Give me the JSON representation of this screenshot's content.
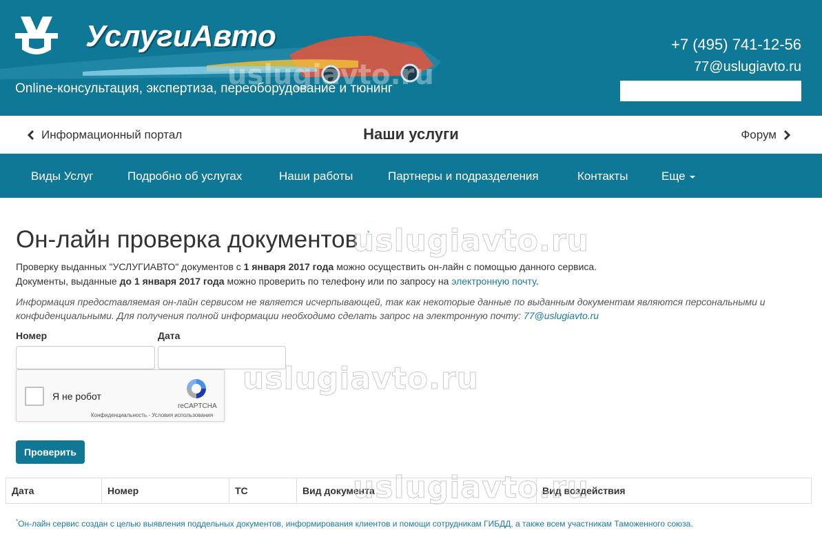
{
  "header": {
    "brand": "УслугиАвто",
    "tagline": "Online-консультация, экспертиза, переоборудование и тюнинг",
    "phone": "+7 (495) 741-12-56",
    "email": "77@uslugiavto.ru",
    "search_placeholder": "",
    "accent_color": "#0f7896"
  },
  "portal": {
    "left_link": "Информационный портал",
    "center_title": "Наши услуги",
    "right_link": "Форум"
  },
  "nav": {
    "items": [
      "Виды Услуг",
      "Подробно об услугах",
      "Наши работы",
      "Партнеры и подразделения",
      "Контакты"
    ],
    "more": "Еще"
  },
  "main": {
    "title": "Он-лайн проверка документов",
    "title_sup": "*",
    "p1_part1": "Проверку выданных \"УСЛУГИАВТО\" документов с ",
    "p1_bold": "1 января 2017 года",
    "p1_part2": " можно осуществить он-лайн с помощью данного сервиса.",
    "p2_part1": "Документы, выданные ",
    "p2_bold": "до 1 января 2017 года",
    "p2_part2": " можно проверить по телефону или по запросу на ",
    "p2_link": "электронную почту",
    "p2_end": ".",
    "note_line1": "Информация предоставляемая он-лайн сервисом не является исчерпывающей, так как некоторые данные по выданным документам являются персональными и",
    "note_line2": "конфиденциальными. Для получения полной информации необходимо сделать запрос на электронную почту: ",
    "note_email": "77@uslugiavto.ru"
  },
  "form": {
    "number_label": "Номер",
    "date_label": "Дата",
    "number_value": "",
    "date_value": "",
    "captcha_label": "Я не робот",
    "captcha_brand": "reCAPTCHA",
    "captcha_terms": "Конфиденциальность - Условия использования",
    "submit_label": "Проверить"
  },
  "table": {
    "columns": [
      "Дата",
      "Номер",
      "ТС",
      "Вид документа",
      "Вид воздействия"
    ]
  },
  "footnote": {
    "mark": "*",
    "text": "Он-лайн сервис создан с целью выявления поддельных документов, информирования клиентов и помощи сотрудникам ГИБДД, а также всем участникам Таможенного союза."
  },
  "watermark": "uslugiavto.ru"
}
